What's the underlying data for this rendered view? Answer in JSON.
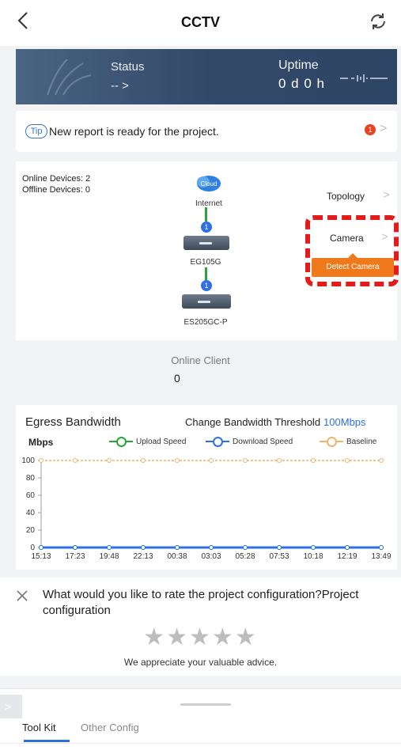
{
  "header": {
    "title": "CCTV",
    "back_icon": "chevron-left-icon",
    "refresh_icon": "refresh-icon"
  },
  "banner": {
    "status_label": "Status",
    "status_value": "-- >",
    "uptime_label": "Uptime",
    "uptime_value": "0 d 0 h"
  },
  "tip": {
    "badge": "Tip",
    "text": "New report is ready for the project.",
    "count": "1"
  },
  "topology": {
    "online_devices": "Online Devices: 2",
    "offline_devices": "Offline Devices: 0",
    "cloud_label": "Cloud",
    "internet_label": "Internet",
    "link1_count": "1",
    "device1": "EG105G",
    "link2_count": "1",
    "device2": "ES205GC-P",
    "topology_link": "Topology",
    "camera_link": "Camera",
    "detect_camera_button": "Detect Camera",
    "accent_color": "#2f6fe6",
    "link_color": "#2aa33a",
    "highlight_color": "#e41b1b",
    "detect_button_color": "#f07a1b"
  },
  "client": {
    "label": "Online Client",
    "value": "0"
  },
  "bandwidth": {
    "title": "Egress Bandwidth",
    "threshold_label": "Change Bandwidth Threshold",
    "threshold_value": "100Mbps",
    "unit": "Mbps",
    "legend": {
      "upload": "Upload Speed",
      "download": "Download Speed",
      "baseline": "Baseline"
    }
  },
  "chart_data": {
    "type": "line",
    "title": "Egress Bandwidth",
    "ylabel": "Mbps",
    "xlabel": "",
    "ylim": [
      0,
      100
    ],
    "yticks": [
      0,
      20,
      40,
      60,
      80,
      100
    ],
    "categories": [
      "15:13",
      "17:23",
      "19:48",
      "22:13",
      "00:38",
      "03:03",
      "05:28",
      "07:53",
      "10:18",
      "12:19",
      "13:49"
    ],
    "series": [
      {
        "name": "Upload Speed",
        "color": "#2aa33a",
        "values": [
          0,
          0,
          0,
          0,
          0,
          0,
          0,
          0,
          0,
          0,
          0
        ]
      },
      {
        "name": "Download Speed",
        "color": "#2f6fe6",
        "values": [
          0,
          0,
          0,
          0,
          0,
          0,
          0,
          0,
          0,
          0,
          0
        ]
      },
      {
        "name": "Baseline",
        "color": "#f0b46a",
        "values": [
          100,
          100,
          100,
          100,
          100,
          100,
          100,
          100,
          100,
          100,
          100
        ]
      }
    ],
    "grid": false,
    "legend_position": "top"
  },
  "rating": {
    "question": "What would you like to rate the project configuration?Project configuration",
    "stars": "★★★★★",
    "note": "We appreciate your valuable advice.",
    "close_icon": "close-icon",
    "star_count": 5,
    "selected_stars": 0
  },
  "bottom": {
    "tabs": [
      {
        "label": "Tool Kit",
        "active": true
      },
      {
        "label": "Other Config",
        "active": false
      }
    ],
    "side_tab_icon": "chevron-right-icon"
  }
}
